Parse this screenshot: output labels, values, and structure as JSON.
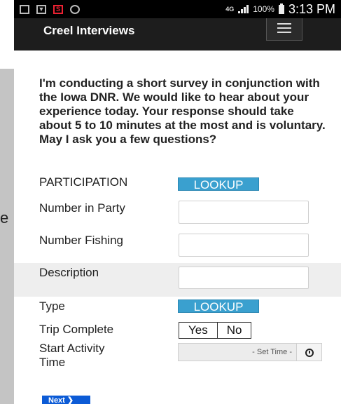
{
  "background": {
    "partial_letter": "e"
  },
  "statusbar": {
    "network": "4G",
    "battery": "100%",
    "time": "3:13 PM"
  },
  "app": {
    "title": "Creel Interviews"
  },
  "intro": "I'm conducting a short survey in conjunction with the Iowa DNR. We would like to hear about your experience today. Your response should take about 5 to 10 minutes at the most and is voluntary. May I ask you a few questions?",
  "form": {
    "participation": {
      "label": "PARTICIPATION",
      "button": "LOOKUP"
    },
    "number_in_party": {
      "label": "Number in Party",
      "value": ""
    },
    "number_fishing": {
      "label": "Number Fishing",
      "value": ""
    },
    "description": {
      "label": "Description",
      "value": ""
    },
    "type": {
      "label": "Type",
      "button": "LOOKUP"
    },
    "trip_complete": {
      "label": "Trip Complete",
      "options": [
        "Yes",
        "No"
      ]
    },
    "start_activity_time": {
      "label_line1": "Start Activity",
      "label_line2": "Time",
      "placeholder": "- Set Time -"
    }
  },
  "next_button": "Next"
}
